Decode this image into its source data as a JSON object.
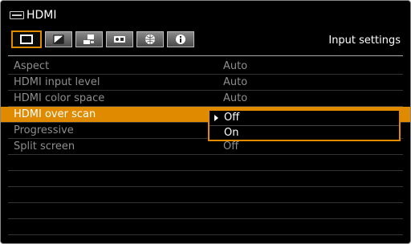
{
  "header": {
    "title": "HDMI",
    "source_icon": "hdmi-connector-icon"
  },
  "tabs": [
    {
      "icon": "picture-icon",
      "active": true
    },
    {
      "icon": "image-adjust-icon",
      "active": false
    },
    {
      "icon": "installation-icon",
      "active": false
    },
    {
      "icon": "system-settings-icon",
      "active": false
    },
    {
      "icon": "network-icon",
      "active": false
    },
    {
      "icon": "information-icon",
      "active": false
    }
  ],
  "tab_caption": "Input settings",
  "menu": {
    "rows": [
      {
        "label": "Aspect",
        "value": "Auto"
      },
      {
        "label": "HDMI input level",
        "value": "Auto"
      },
      {
        "label": "HDMI color space",
        "value": "Auto"
      },
      {
        "label": "HDMI over scan",
        "value": ""
      },
      {
        "label": "Progressive",
        "value": ""
      },
      {
        "label": "Split screen",
        "value": "Off"
      },
      {
        "label": "",
        "value": ""
      },
      {
        "label": "",
        "value": ""
      },
      {
        "label": "",
        "value": ""
      },
      {
        "label": "",
        "value": ""
      },
      {
        "label": "",
        "value": ""
      }
    ]
  },
  "dropdown": {
    "options": [
      "Off",
      "On"
    ],
    "selected": "Off"
  },
  "colors": {
    "accent": "#e08a00",
    "background": "#000000",
    "dim_text": "#8e8e8e"
  }
}
